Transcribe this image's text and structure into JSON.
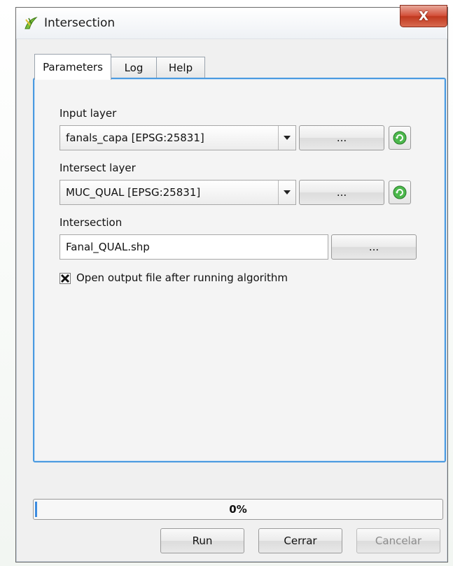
{
  "window": {
    "title": "Intersection",
    "close_label": "X"
  },
  "tabs": [
    {
      "label": "Parameters",
      "active": true
    },
    {
      "label": "Log",
      "active": false
    },
    {
      "label": "Help",
      "active": false
    }
  ],
  "parameters": {
    "input_layer": {
      "label": "Input layer",
      "value": "fanals_capa [EPSG:25831]",
      "browse_label": "..."
    },
    "intersect_layer": {
      "label": "Intersect layer",
      "value": "MUC_QUAL [EPSG:25831]",
      "browse_label": "..."
    },
    "output": {
      "label": "Intersection",
      "value": "Fanal_QUAL.shp",
      "browse_label": "..."
    },
    "open_output": {
      "label": "Open output file after running algorithm",
      "checked": true
    }
  },
  "progress": {
    "value_fraction": 0.0,
    "text": "0%"
  },
  "buttons": {
    "run": "Run",
    "close": "Cerrar",
    "cancel": "Cancelar"
  },
  "colors": {
    "accent": "#4a9ae0",
    "close_button": "#c0391f",
    "refresh_icon": "#3aa83a"
  }
}
